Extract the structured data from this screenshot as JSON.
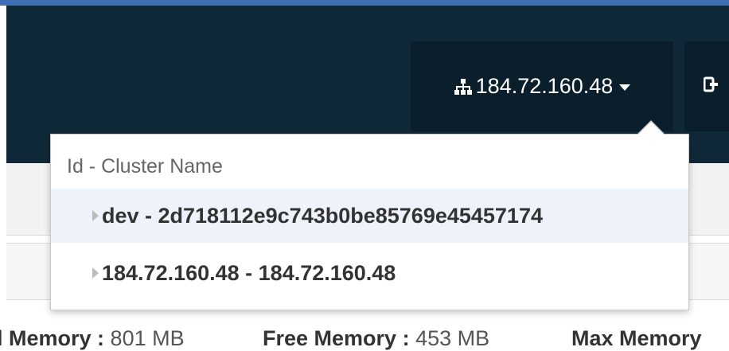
{
  "navbar": {
    "cluster_selector": {
      "icon": "sitemap-icon",
      "label": "184.72.160.48"
    },
    "logout": {
      "icon": "sign-out-icon"
    }
  },
  "cluster_menu": {
    "header": "Id - Cluster Name",
    "items": [
      {
        "label": "dev - 2d718112e9c743b0be85769e45457174",
        "active": true
      },
      {
        "label": "184.72.160.48 - 184.72.160.48",
        "active": false
      }
    ]
  },
  "memory": {
    "used_label": "l Memory :",
    "used_value": "801 MB",
    "free_label": "Free Memory :",
    "free_value": "453 MB",
    "max_label": "Max Memory"
  },
  "colors": {
    "navbar_bg": "#0f2938",
    "button_bg": "#0a1f2b",
    "accent": "#3f6fb5",
    "active_item_bg": "#edf2fb"
  }
}
